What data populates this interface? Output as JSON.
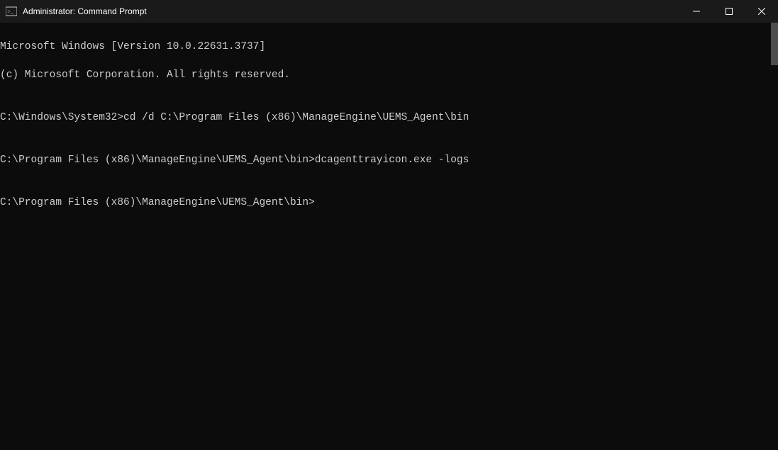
{
  "titlebar": {
    "title": "Administrator: Command Prompt"
  },
  "terminal": {
    "lines": [
      "Microsoft Windows [Version 10.0.22631.3737]",
      "(c) Microsoft Corporation. All rights reserved.",
      "",
      "C:\\Windows\\System32>cd /d C:\\Program Files (x86)\\ManageEngine\\UEMS_Agent\\bin",
      "",
      "C:\\Program Files (x86)\\ManageEngine\\UEMS_Agent\\bin>dcagenttrayicon.exe -logs",
      "",
      "C:\\Program Files (x86)\\ManageEngine\\UEMS_Agent\\bin>"
    ]
  }
}
